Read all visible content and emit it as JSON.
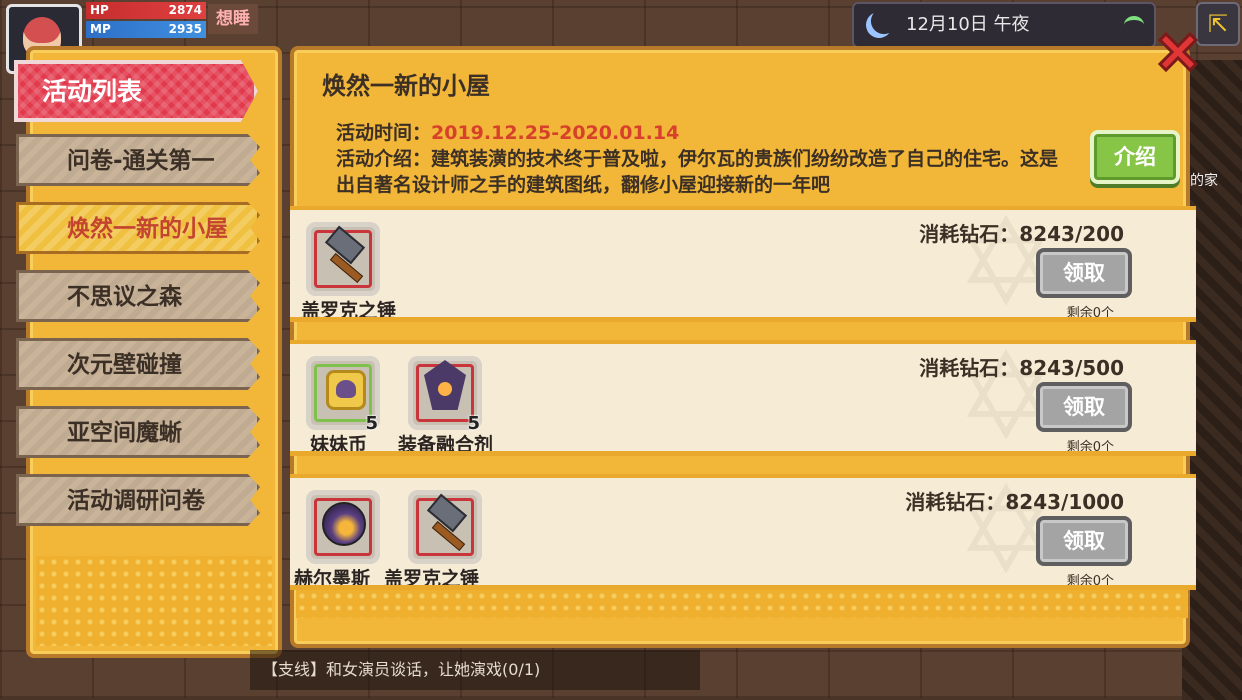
{
  "hud": {
    "hp_label": "HP",
    "hp_value": "2874",
    "mp_label": "MP",
    "mp_value": "2935",
    "sleep_label": "想睡",
    "date_time": "12月10日 午夜",
    "home_label": "的家"
  },
  "sidebar": {
    "header": "活动列表",
    "items": [
      {
        "label": "问卷-通关第一"
      },
      {
        "label": "焕然一新的小屋"
      },
      {
        "label": "不思议之森"
      },
      {
        "label": "次元壁碰撞"
      },
      {
        "label": "亚空间魔蜥"
      },
      {
        "label": "活动调研问卷"
      }
    ],
    "selected_index": 1
  },
  "event": {
    "title": "焕然一新的小屋",
    "time_label": "活动时间：",
    "time_value": "2019.12.25-2020.01.14",
    "intro_text": "活动介绍：建筑装潢的技术终于普及啦，伊尔瓦的贵族们纷纷改造了自己的住宅。这是出自著名设计师之手的建筑图纸，翻修小屋迎接新的一年吧",
    "intro_button": "介绍"
  },
  "rewards": [
    {
      "cost": "消耗钻石：8243/200",
      "claim_label": "领取",
      "remaining": "剩余0个",
      "items": [
        {
          "name": "盖罗克之锤",
          "icon": "hammer-icon",
          "qty": ""
        }
      ]
    },
    {
      "cost": "消耗钻石：8243/500",
      "claim_label": "领取",
      "remaining": "剩余0个",
      "items": [
        {
          "name": "妹妹币",
          "icon": "coin-icon",
          "qty": "5"
        },
        {
          "name": "装备融合剂",
          "icon": "flask-icon",
          "qty": "5"
        }
      ]
    },
    {
      "cost": "消耗钻石：8243/1000",
      "claim_label": "领取",
      "remaining": "剩余0个",
      "items": [
        {
          "name": "赫尔墨斯",
          "icon": "orb-icon",
          "qty": ""
        },
        {
          "name": "盖罗克之锤",
          "icon": "hammer-icon",
          "qty": ""
        }
      ]
    }
  ],
  "quest_text": "【支线】和女演员谈话，让她演戏(0/1)",
  "colors": {
    "panel": "#f2b738",
    "accent_red": "#e23a4d",
    "date_red": "#d7402b",
    "intro_green": "#86c546"
  }
}
